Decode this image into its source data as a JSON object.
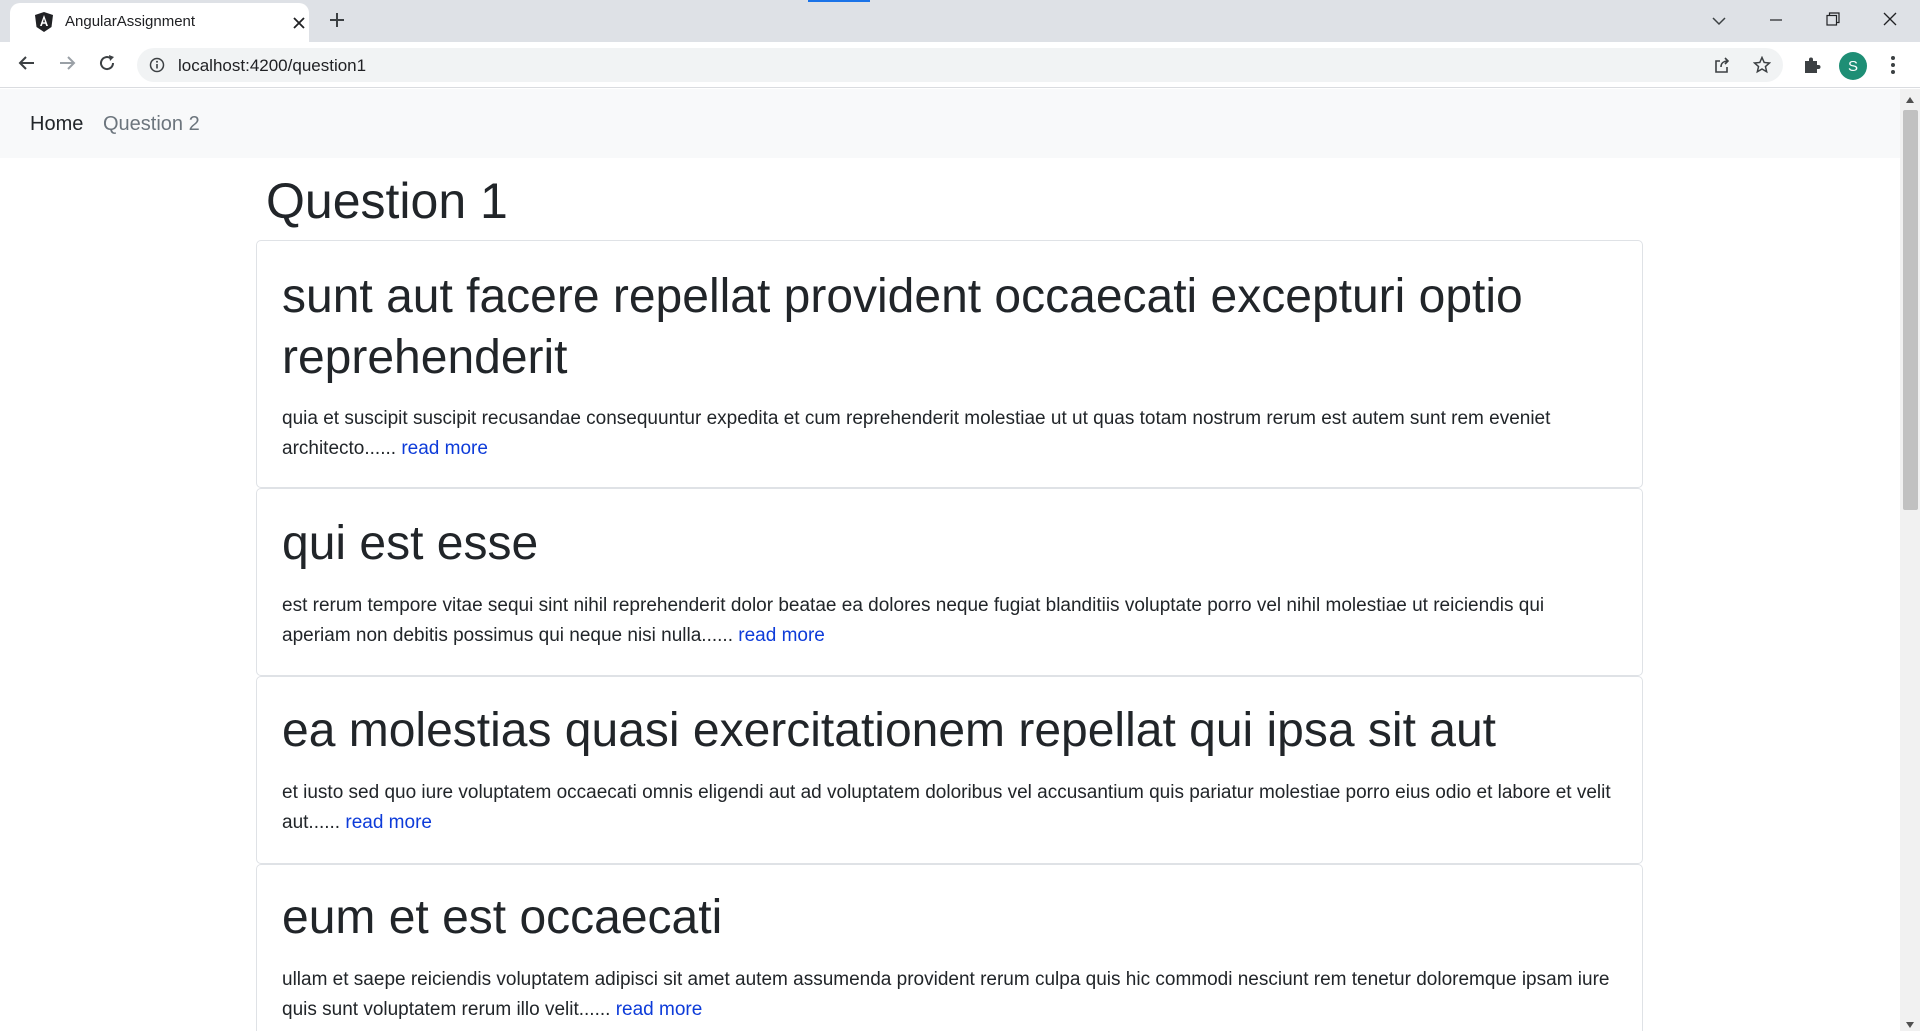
{
  "browser": {
    "tab_title": "AngularAssignment",
    "url": "localhost:4200/question1",
    "profile_initial": "S",
    "accent_color": "#1a73e8",
    "avatar_color": "#1e8e75",
    "icons": {
      "favicon": "angular-logo-icon",
      "tab_close": "close-icon",
      "new_tab": "plus-icon",
      "tab_search": "chevron-down-icon",
      "minimize": "minimize-icon",
      "restore": "restore-icon",
      "close_window": "close-icon",
      "back": "arrow-left-icon",
      "forward": "arrow-right-icon",
      "reload": "reload-icon",
      "site_info": "info-icon",
      "share": "share-icon",
      "bookmark": "star-icon",
      "extensions": "puzzle-icon",
      "menu": "kebab-menu-icon"
    }
  },
  "nav": {
    "home_label": "Home",
    "question2_label": "Question 2"
  },
  "page": {
    "heading": "Question 1"
  },
  "posts": [
    {
      "title": "sunt aut facere repellat provident occaecati excepturi optio reprehenderit",
      "excerpt": "quia et suscipit suscipit recusandae consequuntur expedita et cum reprehenderit molestiae ut ut quas totam nostrum rerum est autem sunt rem eveniet architecto......",
      "link_label": "read more"
    },
    {
      "title": "qui est esse",
      "excerpt": "est rerum tempore vitae sequi sint nihil reprehenderit dolor beatae ea dolores neque fugiat blanditiis voluptate porro vel nihil molestiae ut reiciendis qui aperiam non debitis possimus qui neque nisi nulla......",
      "link_label": "read more"
    },
    {
      "title": "ea molestias quasi exercitationem repellat qui ipsa sit aut",
      "excerpt": "et iusto sed quo iure voluptatem occaecati omnis eligendi aut ad voluptatem doloribus vel accusantium quis pariatur molestiae porro eius odio et labore et velit aut......",
      "link_label": "read more"
    },
    {
      "title": "eum et est occaecati",
      "excerpt": "ullam et saepe reiciendis voluptatem adipisci sit amet autem assumenda provident rerum culpa quis hic commodi nesciunt rem tenetur doloremque ipsam iure quis sunt voluptatem rerum illo velit......",
      "link_label": "read more"
    }
  ],
  "colors": {
    "link": "#0d3bd9",
    "navbar_bg": "#f8f9fa",
    "text": "#212529",
    "muted": "#6c757d"
  }
}
